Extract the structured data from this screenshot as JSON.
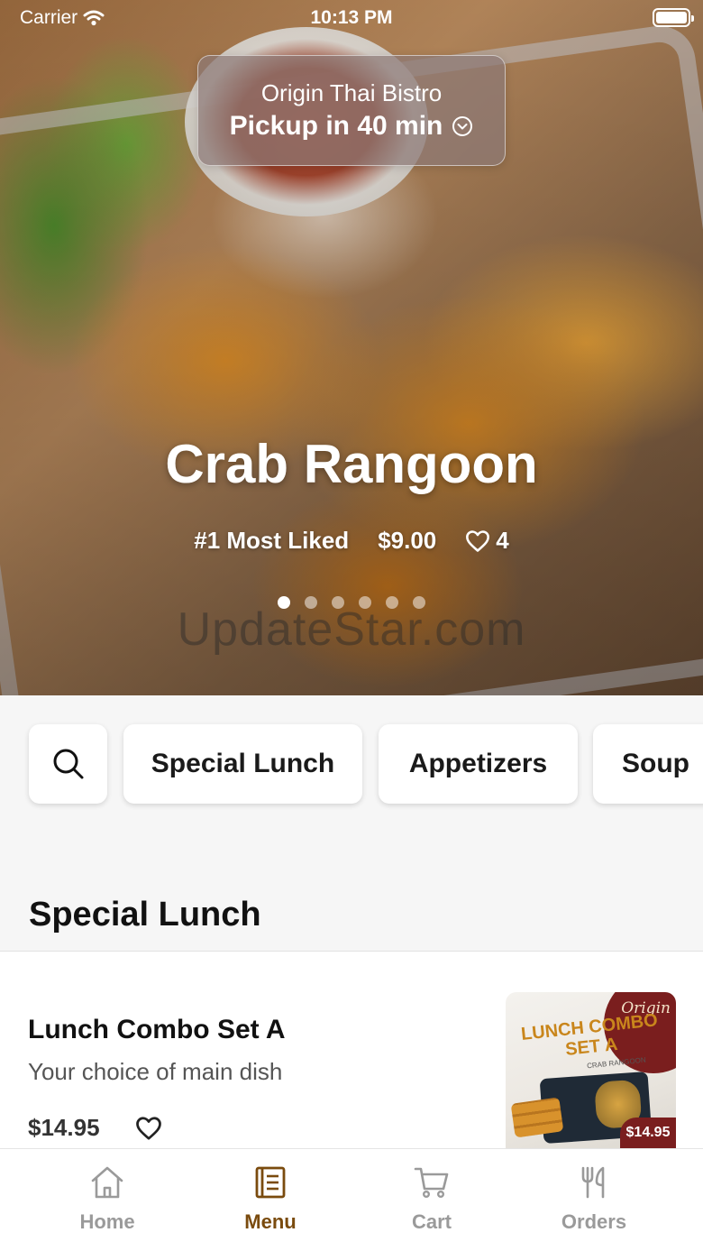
{
  "status_bar": {
    "carrier": "Carrier",
    "time": "10:13 PM"
  },
  "pickup": {
    "restaurant_name": "Origin Thai Bistro",
    "pickup_label": "Pickup in 40 min"
  },
  "hero": {
    "title": "Crab Rangoon",
    "rank_label": "#1 Most Liked",
    "price": "$9.00",
    "likes": "4",
    "page_count": 6,
    "active_page": 1,
    "watermark": "UpdateStar.com"
  },
  "categories": {
    "search_icon": "search-icon",
    "items": [
      {
        "label": "Special Lunch"
      },
      {
        "label": "Appetizers"
      },
      {
        "label": "Soup"
      }
    ]
  },
  "section": {
    "title": "Special Lunch"
  },
  "menu_items": [
    {
      "name": "Lunch Combo Set A",
      "description": "Your choice of main dish",
      "price": "$14.95",
      "image": {
        "brand": "Origin",
        "title_line1": "LUNCH COMBO",
        "title_line2": "SET A",
        "subtitle": "CRAB RANGOON",
        "price_tag": "$14.95"
      }
    }
  ],
  "tab_bar": {
    "tabs": [
      {
        "label": "Home",
        "icon": "home-icon",
        "active": false
      },
      {
        "label": "Menu",
        "icon": "menu-book-icon",
        "active": true
      },
      {
        "label": "Cart",
        "icon": "cart-icon",
        "active": false
      },
      {
        "label": "Orders",
        "icon": "fork-knife-icon",
        "active": false
      }
    ],
    "active_color": "#7a4b0e",
    "inactive_color": "#9a9a9a"
  }
}
